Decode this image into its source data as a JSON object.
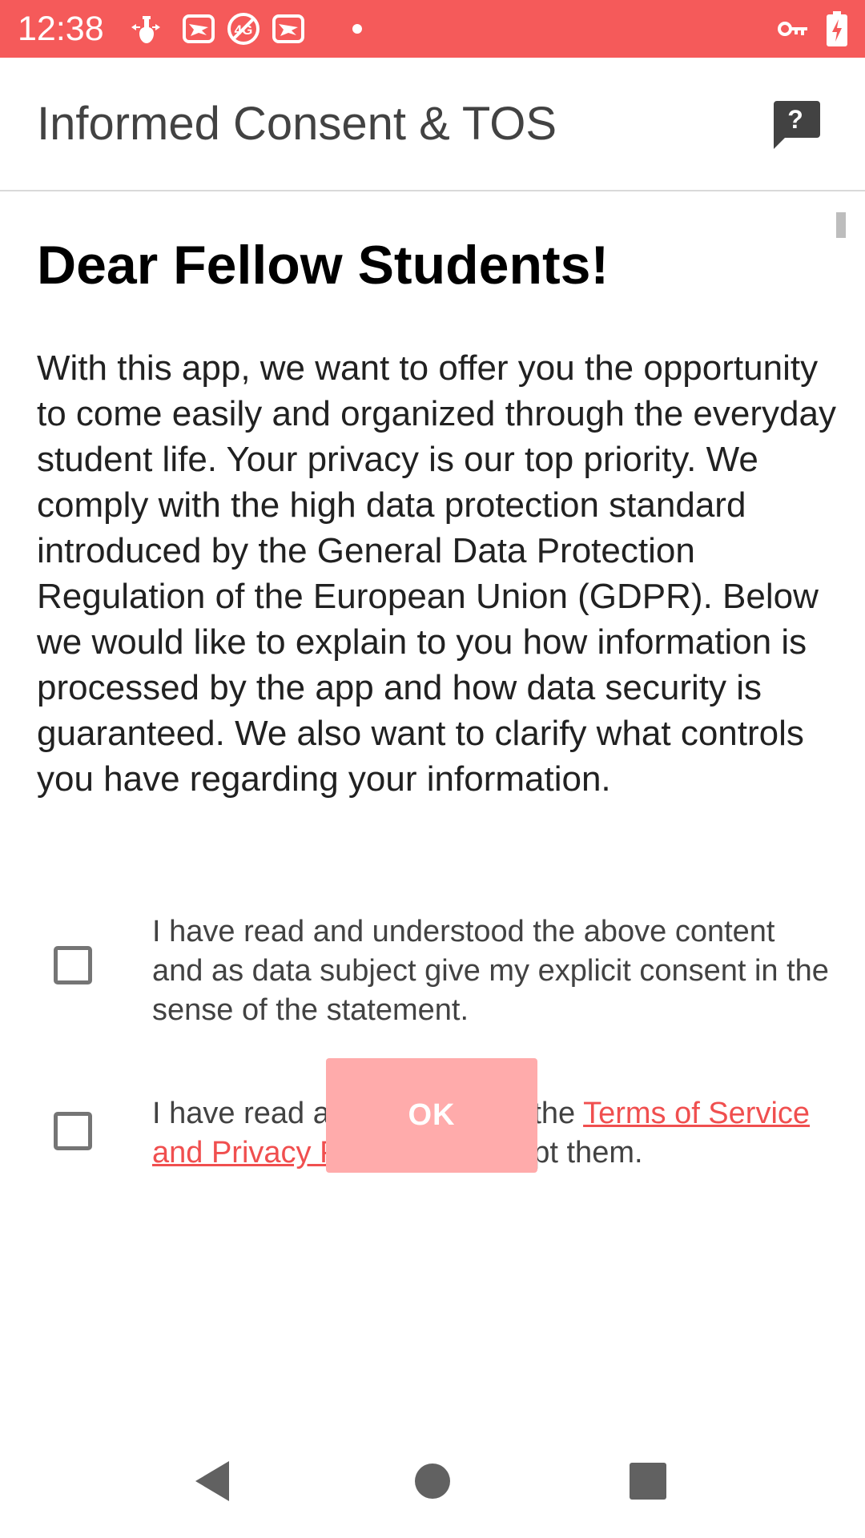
{
  "status_bar": {
    "time": "12:38",
    "background_color": "#f55a5a",
    "left_icons": [
      "usb-icon",
      "notification-icon",
      "no-4g-icon",
      "notification-icon",
      "dot-icon"
    ],
    "right_icons": [
      "vpn-key-icon",
      "battery-charging-icon"
    ]
  },
  "app_bar": {
    "title": "Informed Consent & TOS",
    "help_icon": "help-icon",
    "help_symbol": "?"
  },
  "content": {
    "heading": "Dear Fellow Students!",
    "intro": "With this app, we want to offer you the opportunity to come easily and organized through the everyday student life. Your privacy is our top priority. We comply with the high data protection standard introduced by the General Data Protection Regulation of the European Union (GDPR). Below we would like to explain to you how information is processed by the app and how data security is guaranteed. We also want to clarify what controls you have regarding your information.",
    "consent_checkbox": {
      "checked": false,
      "label": "I have read and understood the above content and as data subject give my explicit consent in the sense of the statement."
    },
    "tos_checkbox": {
      "checked": false,
      "label_before": "I have read and understood the ",
      "link_text": "Terms of Service and Privacy Policy",
      "label_after": " and accept them."
    },
    "ok_button": {
      "label": "OK",
      "enabled": false
    }
  },
  "nav_bar": {
    "back_icon": "back-icon",
    "home_icon": "home-icon",
    "recents_icon": "recents-icon"
  },
  "colors": {
    "accent": "#f04f4f",
    "button_disabled": "#ffabab",
    "status_bar": "#f55a5a"
  }
}
